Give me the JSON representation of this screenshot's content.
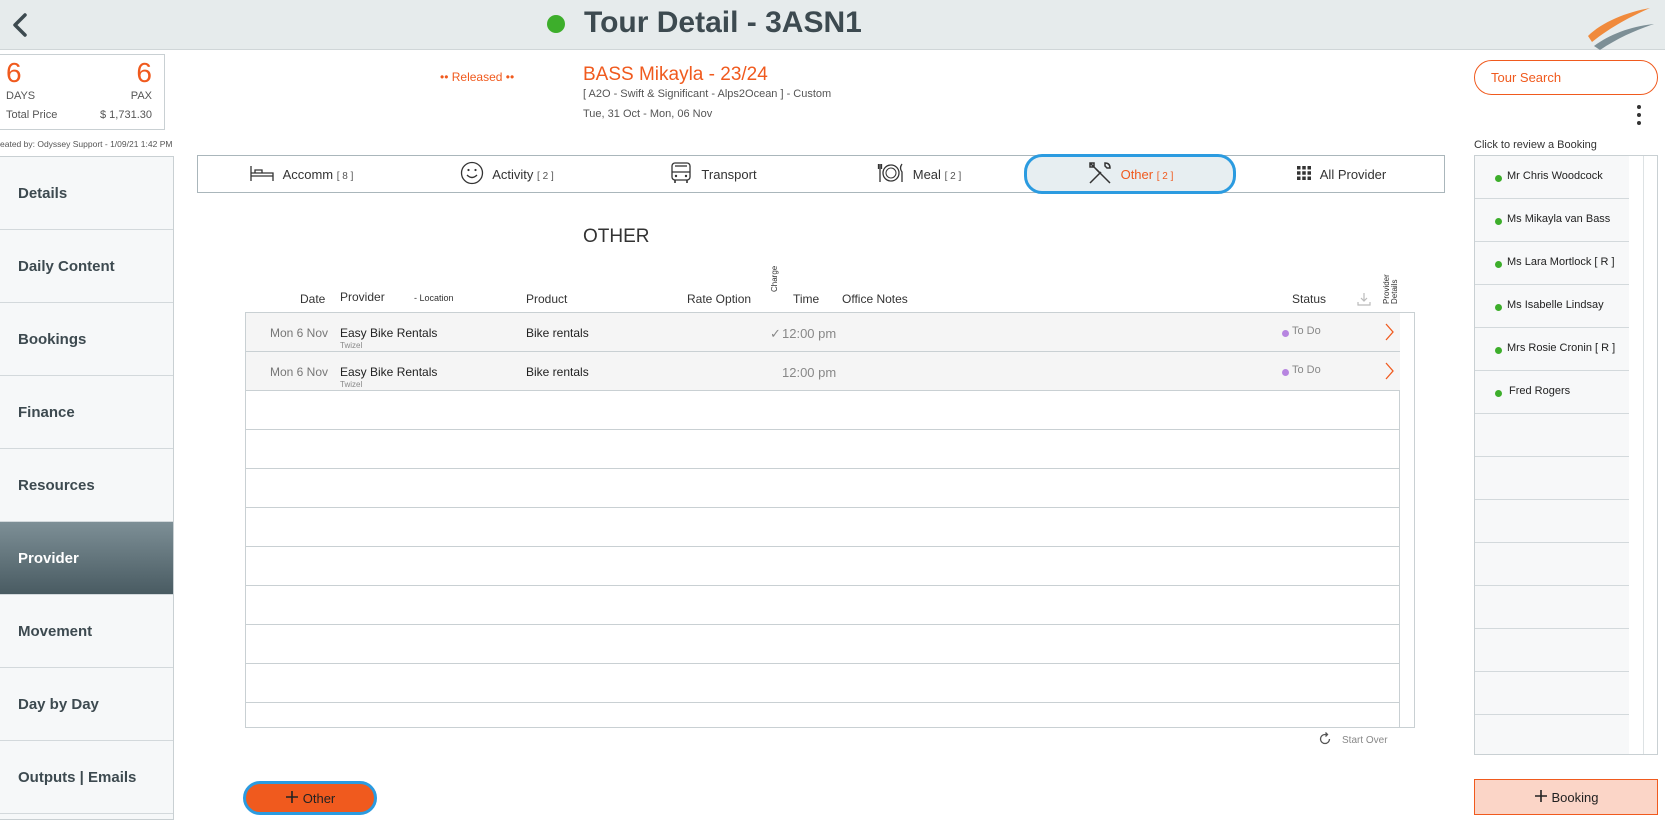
{
  "header": {
    "title": "Tour Detail - 3ASN1",
    "status_color": "#3dae2b"
  },
  "summary": {
    "days": "6",
    "days_label": "DAYS",
    "pax": "6",
    "pax_label": "PAX",
    "total_price_label": "Total Price",
    "total_price": "$ 1,731.30",
    "created_by": "eated by: Odyssey Support - 1/09/21 1:42 PM"
  },
  "sidebar": {
    "items": [
      {
        "label": "Details"
      },
      {
        "label": "Daily Content"
      },
      {
        "label": "Bookings"
      },
      {
        "label": "Finance"
      },
      {
        "label": "Resources"
      },
      {
        "label": "Provider"
      },
      {
        "label": "Movement"
      },
      {
        "label": "Day by Day"
      },
      {
        "label": "Outputs | Emails"
      }
    ],
    "active_index": 5
  },
  "tour": {
    "status": "•• Released ••",
    "name": "BASS Mikayla - 23/24",
    "subtitle": "[ A2O - Swift & Significant - Alps2Ocean ] - Custom",
    "dates": "Tue, 31 Oct  - Mon, 06 Nov"
  },
  "tabs": [
    {
      "label": "Accomm",
      "count": "[ 8 ]",
      "icon": "bed-icon"
    },
    {
      "label": "Activity",
      "count": "[ 2 ]",
      "icon": "smiley-icon"
    },
    {
      "label": "Transport",
      "count": "",
      "icon": "bus-icon"
    },
    {
      "label": "Meal",
      "count": "[ 2 ]",
      "icon": "plate-icon"
    },
    {
      "label": "Other",
      "count": "[ 2 ]",
      "icon": "tools-icon"
    },
    {
      "label": "All Provider",
      "count": "",
      "icon": "grid-icon"
    }
  ],
  "section_title": "OTHER",
  "table": {
    "headers": {
      "date": "Date",
      "provider": "Provider",
      "location": "- Location",
      "product": "Product",
      "rate_option": "Rate Option",
      "charge": "Charge",
      "time": "Time",
      "office_notes": "Office Notes",
      "status": "Status",
      "provider_details": "Provider Details"
    },
    "rows": [
      {
        "date": "Mon 6 Nov",
        "provider": "Easy Bike Rentals",
        "location": "Twizel",
        "product": "Bike rentals",
        "charge": "✓",
        "time": "12:00 pm",
        "status": "To Do"
      },
      {
        "date": "Mon 6 Nov",
        "provider": "Easy Bike Rentals",
        "location": "Twizel",
        "product": "Bike rentals",
        "charge": "",
        "time": "12:00 pm",
        "status": "To Do"
      }
    ]
  },
  "start_over": "Start Over",
  "add_other": "Other",
  "right": {
    "tour_search": "Tour Search",
    "click_review": "Click to review a Booking",
    "passengers": [
      "Mr Chris Woodcock",
      "Ms Mikayla van Bass",
      "Ms Lara Mortlock  [ R ]",
      "Ms Isabelle Lindsay",
      "Mrs Rosie Cronin  [ R ]",
      "Fred Rogers"
    ],
    "add_booking": "Booking"
  },
  "colors": {
    "accent": "#f05a1e",
    "highlight": "#2b9be0",
    "status_todo": "#b785e0"
  }
}
